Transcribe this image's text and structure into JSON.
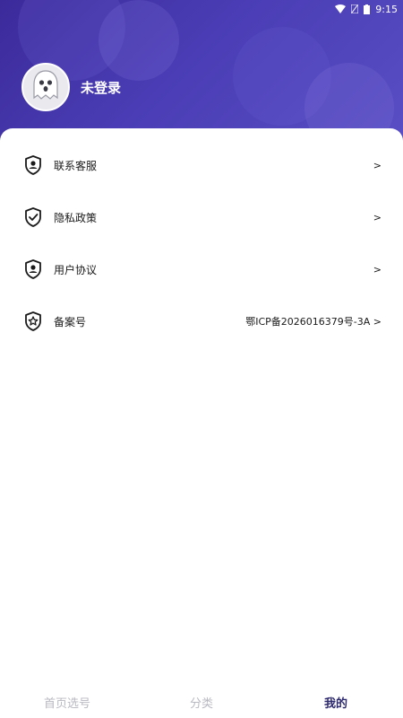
{
  "status_bar": {
    "time": "9:15",
    "icons": [
      "wifi-icon",
      "signal-icon",
      "battery-icon"
    ]
  },
  "colors": {
    "header_gradient_start": "#3b2a9a",
    "header_gradient_end": "#5a4fc4",
    "active_tab": "#2e2a6e",
    "inactive_tab": "#b9b9c2"
  },
  "profile": {
    "avatar_icon": "ghost-icon",
    "name": "未登录"
  },
  "menu": {
    "items": [
      {
        "icon": "shield-user-icon",
        "label": "联系客服",
        "value": ">"
      },
      {
        "icon": "shield-check-icon",
        "label": "隐私政策",
        "value": ">"
      },
      {
        "icon": "shield-user-icon",
        "label": "用户协议",
        "value": ">"
      },
      {
        "icon": "shield-star-icon",
        "label": "备案号",
        "value": "鄂ICP备2026016379号-3A >"
      }
    ]
  },
  "bottom_nav": {
    "tabs": [
      {
        "label": "首页选号",
        "active": false
      },
      {
        "label": "分类",
        "active": false
      },
      {
        "label": "我的",
        "active": true
      }
    ]
  }
}
